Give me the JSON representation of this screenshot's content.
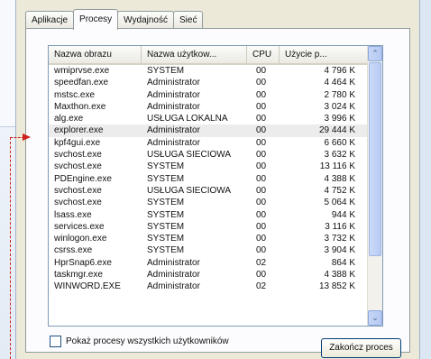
{
  "tabs": [
    {
      "label": "Aplikacje"
    },
    {
      "label": "Procesy"
    },
    {
      "label": "Wydajność"
    },
    {
      "label": "Sieć"
    }
  ],
  "columns": [
    "Nazwa obrazu",
    "Nazwa użytkow...",
    "CPU",
    "Użycie p..."
  ],
  "rows": [
    {
      "name": "wmiprvse.exe",
      "user": "SYSTEM",
      "cpu": "00",
      "mem": "4 796 K"
    },
    {
      "name": "speedfan.exe",
      "user": "Administrator",
      "cpu": "00",
      "mem": "4 464 K"
    },
    {
      "name": "mstsc.exe",
      "user": "Administrator",
      "cpu": "00",
      "mem": "2 780 K"
    },
    {
      "name": "Maxthon.exe",
      "user": "Administrator",
      "cpu": "00",
      "mem": "3 024 K"
    },
    {
      "name": "alg.exe",
      "user": "USŁUGA LOKALNA",
      "cpu": "00",
      "mem": "3 996 K"
    },
    {
      "name": "explorer.exe",
      "user": "Administrator",
      "cpu": "00",
      "mem": "29 444 K"
    },
    {
      "name": "kpf4gui.exe",
      "user": "Administrator",
      "cpu": "00",
      "mem": "6 660 K"
    },
    {
      "name": "svchost.exe",
      "user": "USŁUGA SIECIOWA",
      "cpu": "00",
      "mem": "3 632 K"
    },
    {
      "name": "svchost.exe",
      "user": "SYSTEM",
      "cpu": "00",
      "mem": "13 116 K"
    },
    {
      "name": "PDEngine.exe",
      "user": "SYSTEM",
      "cpu": "00",
      "mem": "4 388 K"
    },
    {
      "name": "svchost.exe",
      "user": "USŁUGA SIECIOWA",
      "cpu": "00",
      "mem": "4 752 K"
    },
    {
      "name": "svchost.exe",
      "user": "SYSTEM",
      "cpu": "00",
      "mem": "5 064 K"
    },
    {
      "name": "lsass.exe",
      "user": "SYSTEM",
      "cpu": "00",
      "mem": "944 K"
    },
    {
      "name": "services.exe",
      "user": "SYSTEM",
      "cpu": "00",
      "mem": "3 116 K"
    },
    {
      "name": "winlogon.exe",
      "user": "SYSTEM",
      "cpu": "00",
      "mem": "3 732 K"
    },
    {
      "name": "csrss.exe",
      "user": "SYSTEM",
      "cpu": "00",
      "mem": "3 904 K"
    },
    {
      "name": "HprSnap6.exe",
      "user": "Administrator",
      "cpu": "02",
      "mem": "864 K"
    },
    {
      "name": "taskmgr.exe",
      "user": "Administrator",
      "cpu": "00",
      "mem": "4 388 K"
    },
    {
      "name": "WINWORD.EXE",
      "user": "Administrator",
      "cpu": "02",
      "mem": "13 852 K"
    }
  ],
  "show_all_label": "Pokaż procesy wszystkich użytkowników",
  "end_process_label": "Zakończ proces",
  "scroll_up_glyph": "⌃",
  "scroll_down_glyph": "⌄",
  "colors": {
    "selected_row": "#ececec",
    "annotation_arrow": "#d0201c"
  }
}
